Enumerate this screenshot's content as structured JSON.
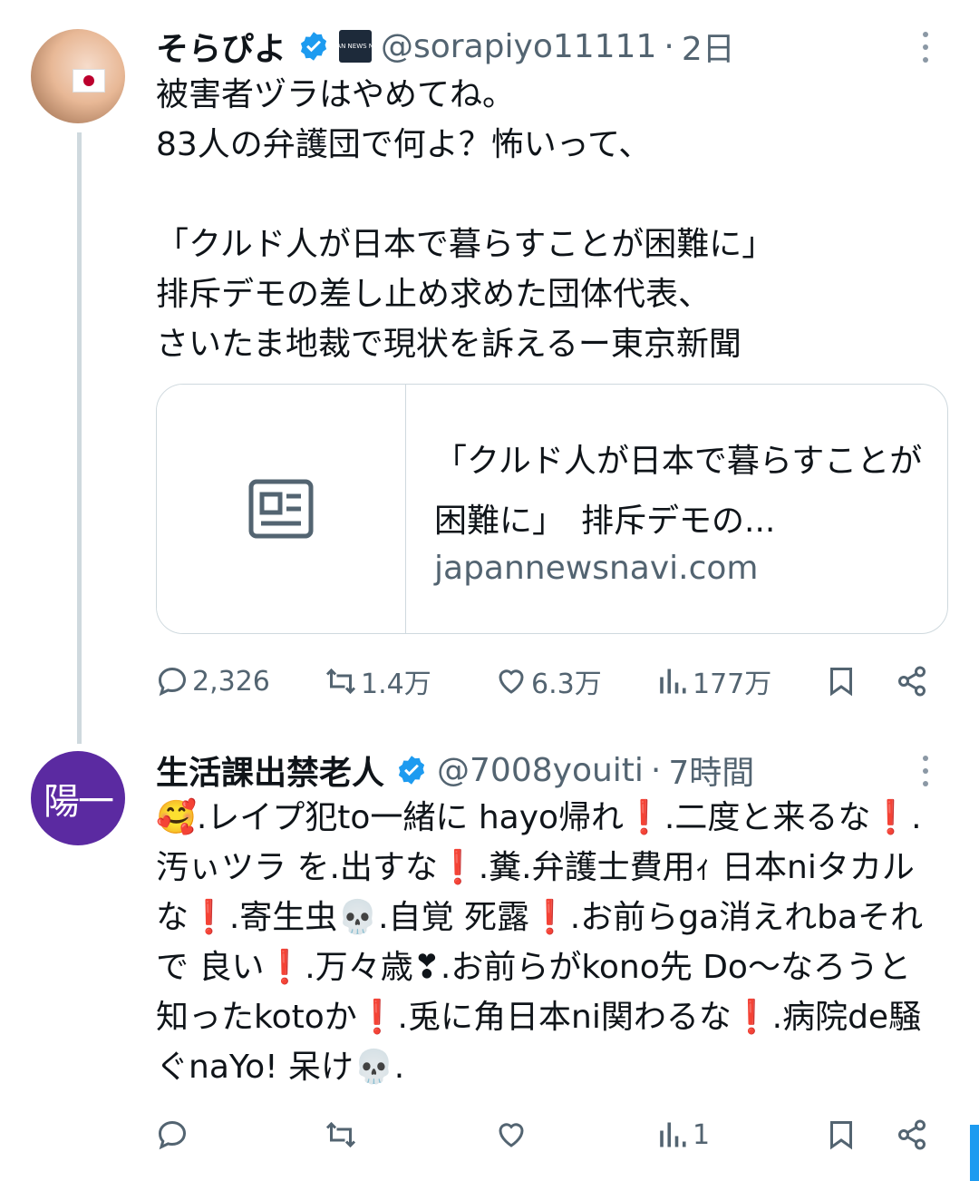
{
  "tweet1": {
    "name": "そらぴよ",
    "affiliate": "JAPAN NEWS NAVI",
    "handle": "@sorapiyo11111",
    "time": "2日",
    "body": "被害者ヅラはやめてね。\n83人の弁護団で何よ？怖いって、\n\n「クルド人が日本で暮らすことが困難に」\n排斥デモの差し止め求めた団体代表、\nさいたま地裁で現状を訴えるー東京新聞",
    "card": {
      "title": "「クルド人が日本で暮らすことが困難に」　排斥デモの...",
      "domain": "japannewsnavi.com",
      "thumb_icon": "news-article-icon"
    },
    "stats": {
      "replies": "2,326",
      "reposts": "1.4万",
      "likes": "6.3万",
      "views": "177万"
    }
  },
  "tweet2": {
    "avatar_text": "陽一",
    "name": "生活課出禁老人",
    "handle": "@7008youiti",
    "time": "7時間",
    "body": "🥰.レイプ犯to一緒に hayo帰れ❗.二度と来るな❗.汚ぃツラ を.出すな❗.糞.弁護士費用ｨ 日本niタカルな❗.寄生虫💀.自覚 死露❗.お前らga消えれbaそれで 良い❗.万々歳❣.お前らがkono先 Do〜なろうと 知ったkotoか❗.兎に角日本ni関わるな❗.病院de騒ぐnaYo! 呆け💀.",
    "stats": {
      "replies": "",
      "reposts": "",
      "likes": "",
      "views": "1"
    }
  },
  "colors": {
    "verified": "#1d9bf0",
    "secondary_text": "#536471",
    "border": "#cfd9de"
  }
}
